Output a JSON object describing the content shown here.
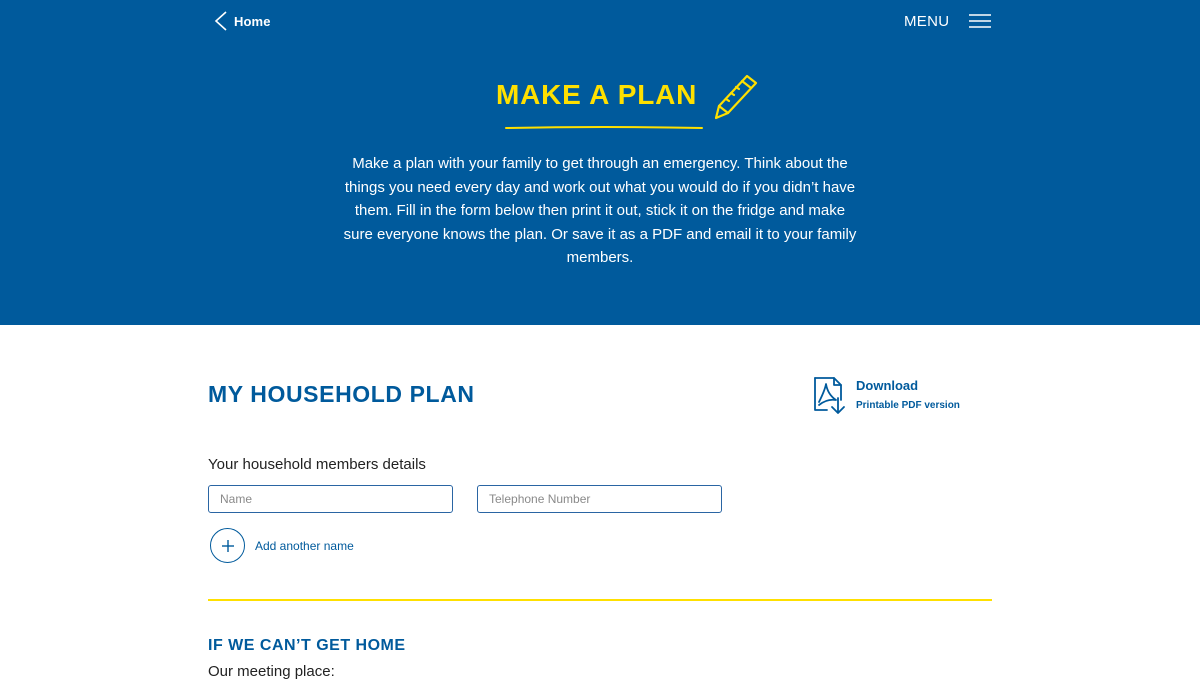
{
  "nav": {
    "home_label": "Home",
    "menu_label": "MENU"
  },
  "hero": {
    "title": "MAKE A PLAN",
    "description": "Make a plan with your family to get through an emergency. Think about the things you need every day and work out what you would do if you didn’t have them. Fill in the form below then print it out, stick it on the fridge and make sure everyone knows the plan. Or save it as a PDF and email it to your family members."
  },
  "plan": {
    "title": "MY HOUSEHOLD PLAN",
    "download_label": "Download",
    "download_sublabel": "Printable PDF version",
    "members_label": "Your household members details",
    "name_placeholder": "Name",
    "phone_placeholder": "Telephone Number",
    "add_label": "Add another name"
  },
  "cant_get_home": {
    "title": "IF WE CAN’T GET HOME",
    "meeting_label": "Our meeting place:"
  },
  "colors": {
    "brand_blue": "#005a9c",
    "accent_yellow": "#ffe000",
    "white": "#ffffff"
  },
  "icons": {
    "back": "chevron-left-icon",
    "menu": "hamburger-icon",
    "pencil": "pencil-icon",
    "pdf": "pdf-download-icon",
    "add": "plus-icon"
  }
}
